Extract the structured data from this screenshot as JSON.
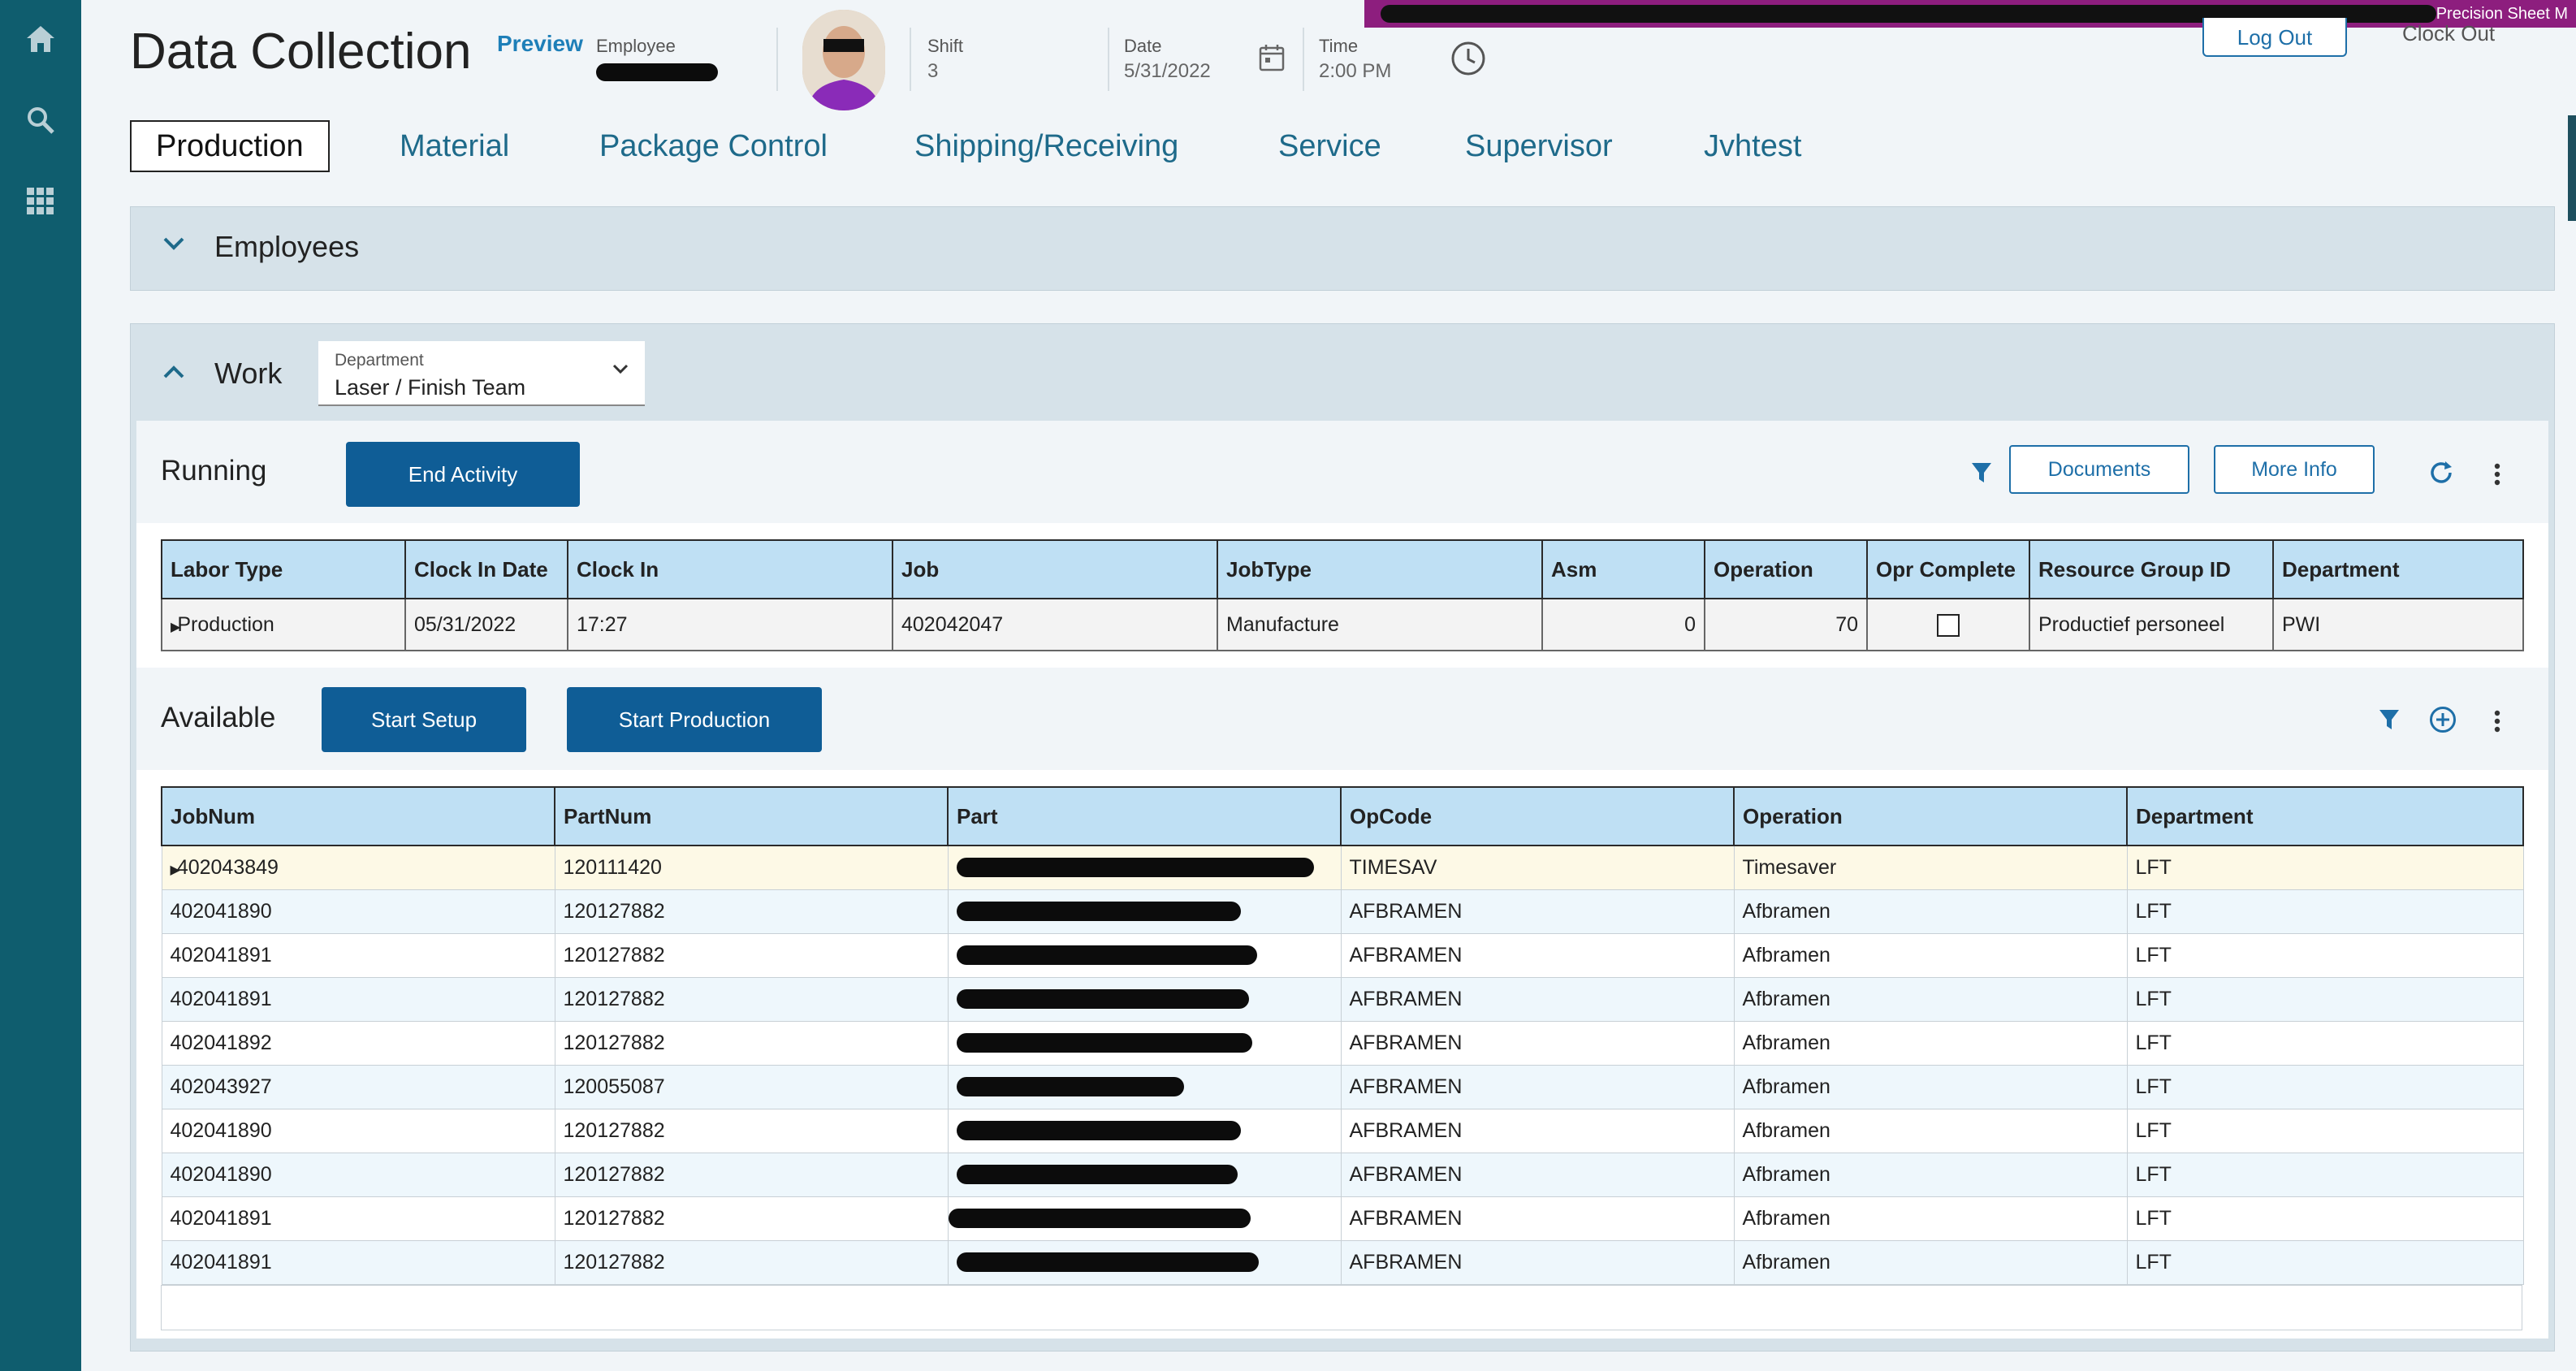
{
  "header": {
    "title": "Data Collection",
    "preview": "Preview",
    "employee_label": "Employee",
    "shift_label": "Shift",
    "shift_value": "3",
    "date_label": "Date",
    "date_value": "5/31/2022",
    "time_label": "Time",
    "time_value": "2:00 PM",
    "logout_label": "Log Out",
    "clockout_label": "Clock Out",
    "top_banner_text": "Precision Sheet M"
  },
  "tabs": [
    "Production",
    "Material",
    "Package Control",
    "Shipping/Receiving",
    "Service",
    "Supervisor",
    "Jvhtest"
  ],
  "employees_panel": {
    "title": "Employees"
  },
  "work_panel": {
    "title": "Work",
    "department_label": "Department",
    "department_value": "Laser / Finish Team"
  },
  "running": {
    "label": "Running",
    "end_activity": "End Activity",
    "documents": "Documents",
    "more_info": "More Info",
    "columns": [
      "Labor Type",
      "Clock In Date",
      "Clock In",
      "Job",
      "JobType",
      "Asm",
      "Operation",
      "Opr Complete",
      "Resource Group ID",
      "Department"
    ],
    "row": {
      "labor_type": "Production",
      "clock_in_date": "05/31/2022",
      "clock_in": "17:27",
      "job": "402042047",
      "job_type": "Manufacture",
      "asm": "0",
      "operation": "70",
      "resource_group": "Productief personeel",
      "department": "PWI"
    }
  },
  "available": {
    "label": "Available",
    "start_setup": "Start Setup",
    "start_production": "Start Production",
    "columns": [
      "JobNum",
      "PartNum",
      "Part",
      "OpCode",
      "Operation",
      "Department"
    ],
    "rows": [
      {
        "job": "402043849",
        "part_num": "120111420",
        "opcode": "TIMESAV",
        "operation": "Timesaver",
        "dept": "LFT"
      },
      {
        "job": "402041890",
        "part_num": "120127882",
        "opcode": "AFBRAMEN",
        "operation": "Afbramen",
        "dept": "LFT"
      },
      {
        "job": "402041891",
        "part_num": "120127882",
        "opcode": "AFBRAMEN",
        "operation": "Afbramen",
        "dept": "LFT"
      },
      {
        "job": "402041891",
        "part_num": "120127882",
        "opcode": "AFBRAMEN",
        "operation": "Afbramen",
        "dept": "LFT"
      },
      {
        "job": "402041892",
        "part_num": "120127882",
        "opcode": "AFBRAMEN",
        "operation": "Afbramen",
        "dept": "LFT"
      },
      {
        "job": "402043927",
        "part_num": "120055087",
        "opcode": "AFBRAMEN",
        "operation": "Afbramen",
        "dept": "LFT"
      },
      {
        "job": "402041890",
        "part_num": "120127882",
        "opcode": "AFBRAMEN",
        "operation": "Afbramen",
        "dept": "LFT"
      },
      {
        "job": "402041890",
        "part_num": "120127882",
        "opcode": "AFBRAMEN",
        "operation": "Afbramen",
        "dept": "LFT"
      },
      {
        "job": "402041891",
        "part_num": "120127882",
        "opcode": "AFBRAMEN",
        "operation": "Afbramen",
        "dept": "LFT"
      },
      {
        "job": "402041891",
        "part_num": "120127882",
        "opcode": "AFBRAMEN",
        "operation": "Afbramen",
        "dept": "LFT"
      }
    ]
  },
  "icons": {
    "sidebar": [
      "home-icon",
      "search-icon",
      "apps-grid-icon"
    ],
    "header": [
      "calendar-icon",
      "clock-icon"
    ],
    "running_tools": [
      "filter-icon",
      "refresh-icon",
      "more-vert-icon"
    ],
    "available_tools": [
      "filter-icon",
      "add-circle-icon",
      "more-vert-icon"
    ]
  },
  "colors": {
    "sidebar": "#0f5d6e",
    "accent": "#1e6fa8",
    "primary_button": "#0f5d96",
    "grid_header": "#bfe0f4",
    "panel": "#d6e2e9",
    "redaction_banner": "#8d1e7e"
  }
}
